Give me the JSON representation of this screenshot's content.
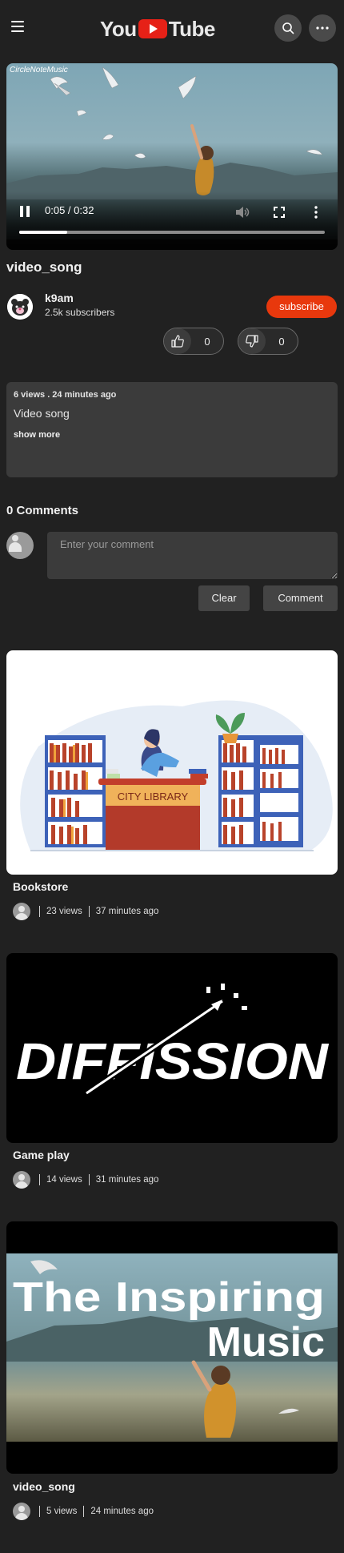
{
  "header": {
    "logo_left": "You",
    "logo_right": "Tube"
  },
  "player": {
    "watermark": "CircleNoteMusic",
    "current_time": "0:05",
    "duration": "0:32",
    "time_text": "0:05 / 0:32",
    "progress_fraction": 0.156
  },
  "video": {
    "title": "video_song",
    "channel_name": "k9am",
    "subscribers": "2.5k subscribers",
    "subscribe_label": "subscribe",
    "likes": "0",
    "dislikes": "0"
  },
  "description": {
    "meta": "6 views . 24 minutes ago",
    "text": "Video song",
    "show_more": "show more"
  },
  "comments": {
    "title": "0 Comments",
    "placeholder": "Enter your comment",
    "clear_label": "Clear",
    "comment_label": "Comment"
  },
  "related": [
    {
      "title": "Bookstore",
      "views": "23 views",
      "time": "37 minutes ago",
      "thumb_text": "CITY LIBRARY"
    },
    {
      "title": "Game play",
      "views": "14 views",
      "time": "31 minutes ago",
      "thumb_text": "DIFFISSION"
    },
    {
      "title": "video_song",
      "views": "5 views",
      "time": "24 minutes ago",
      "thumb_text_line1": "The Inspiring",
      "thumb_text_line2": "Music"
    }
  ],
  "colors": {
    "background": "#212121",
    "accent_red": "#e8380d",
    "surface": "#3b3b3b"
  }
}
